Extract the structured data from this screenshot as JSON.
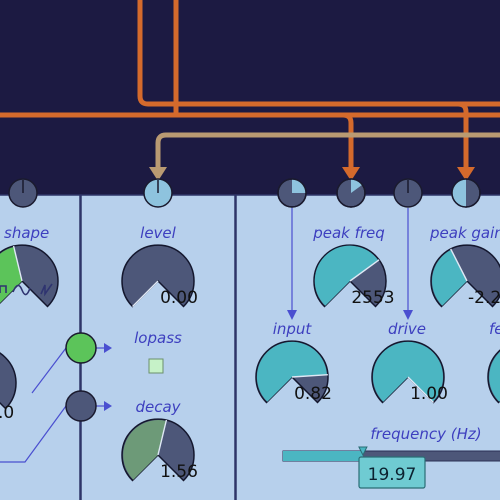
{
  "colors": {
    "background": "#1c1a42",
    "panel": "#b7d0ec",
    "cable_orange": "#d46a2c",
    "cable_tan": "#b99a72",
    "knob_teal": "#4bb6c2",
    "knob_green": "#5cc45a",
    "knob_sage": "#6d9a78",
    "knob_body": "#4d5779",
    "label": "#3d3fbf"
  },
  "modules": {
    "oscillator": {
      "shape_label": "shape",
      "shape_level": 0.45,
      "waveform_icons": [
        "square-wave-icon",
        "sine-wave-icon",
        "sawtooth-wave-icon"
      ],
      "partial_value": ".0"
    },
    "envelope": {
      "level_label": "level",
      "level_value": "0.00",
      "level_level": 0.0,
      "lopass_label": "lopass",
      "lopass_checked": false,
      "decay_label": "decay",
      "decay_value": "1.56",
      "decay_level": 0.55
    },
    "filter": {
      "peak_freq_label": "peak freq",
      "peak_freq_value": "2553",
      "peak_freq_level": 0.7,
      "peak_gain_label": "peak gain",
      "peak_gain_value": "-2.2",
      "peak_gain_level": 0.4,
      "input_label": "input",
      "input_value": "0.82",
      "input_level": 0.82,
      "drive_label": "drive",
      "drive_value": "1.00",
      "drive_level": 1.0,
      "feedback_label_partial": "fe",
      "frequency_label": "frequency (Hz)",
      "frequency_value": "19.97",
      "frequency_level": 0.36
    }
  }
}
